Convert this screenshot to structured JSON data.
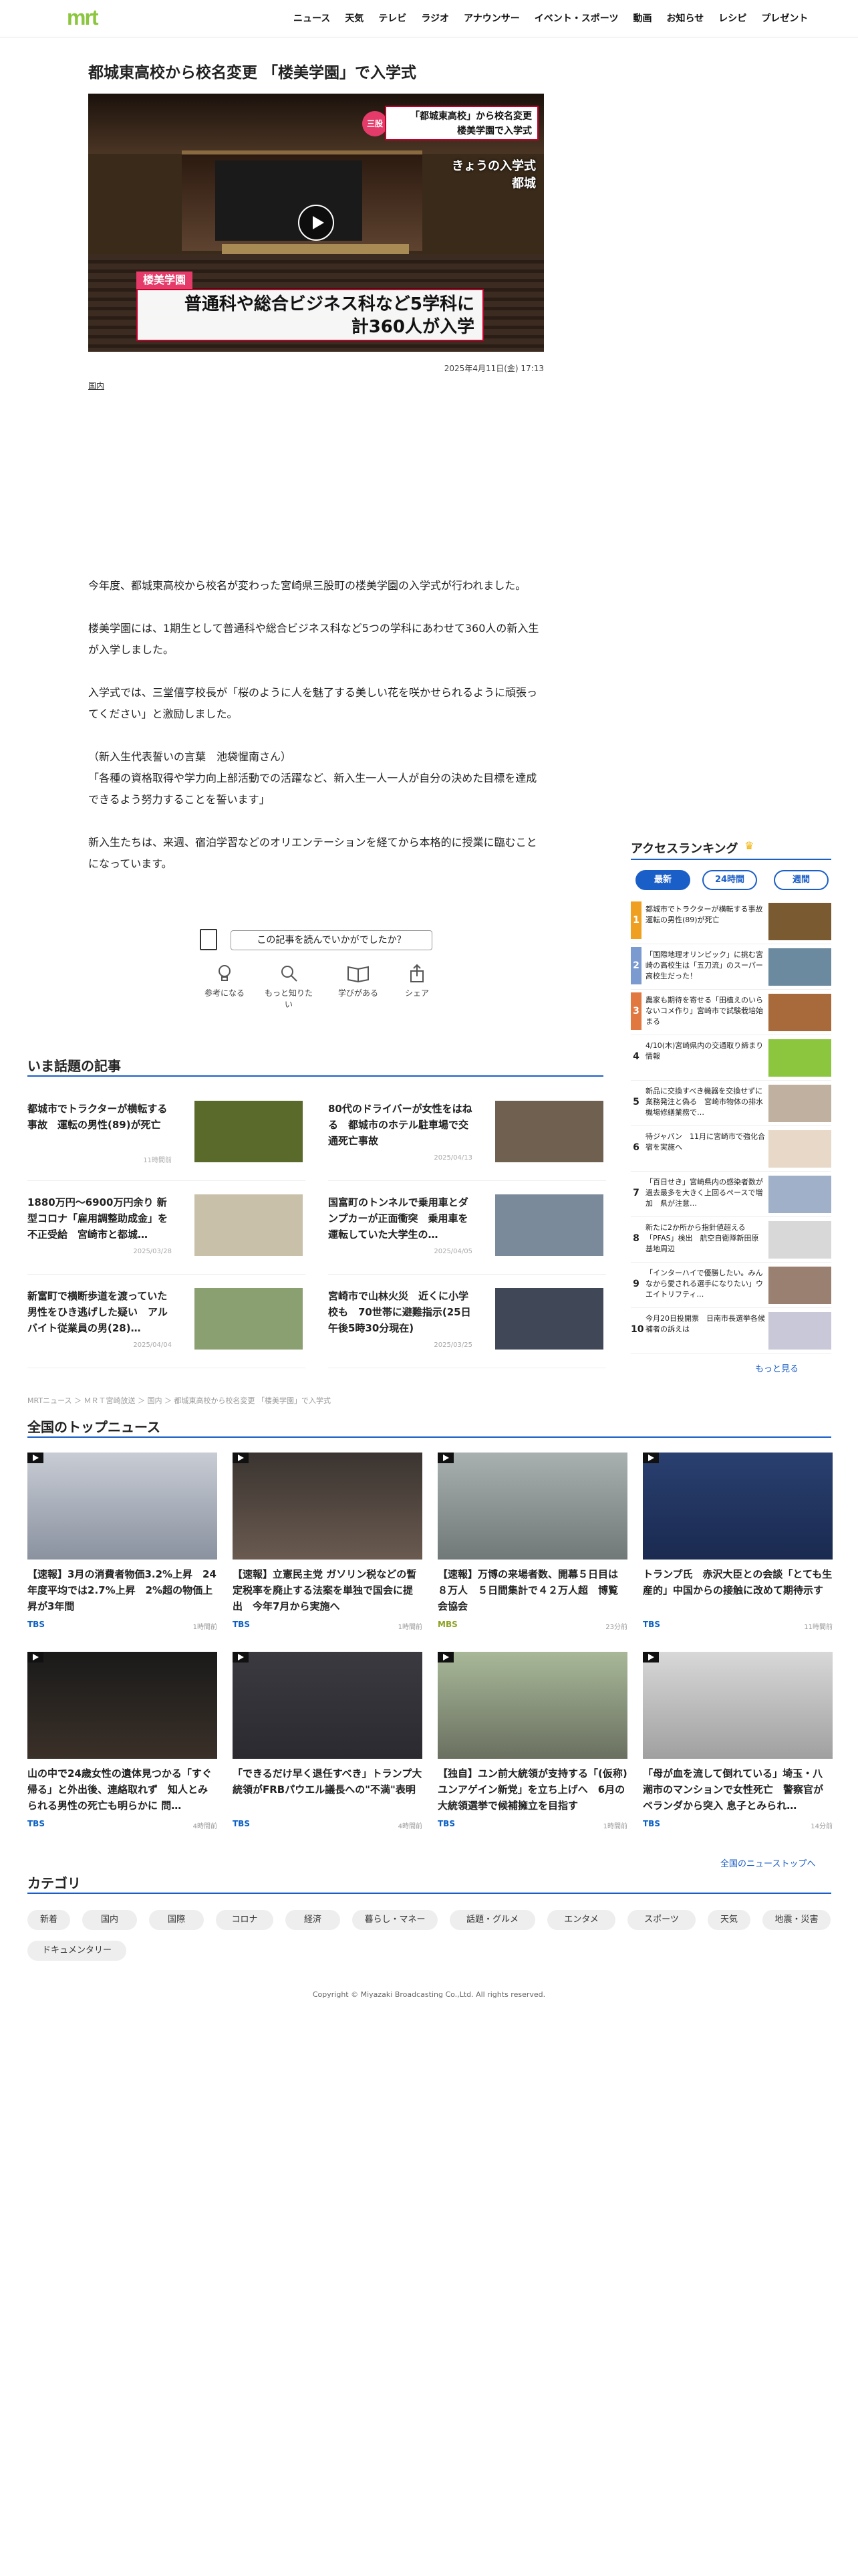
{
  "header": {
    "logo": "mrt",
    "nav": [
      "ニュース",
      "天気",
      "テレビ",
      "ラジオ",
      "アナウンサー",
      "イベント・スポーツ",
      "動画",
      "お知らせ",
      "レシピ",
      "プレゼント"
    ]
  },
  "article": {
    "title": "都城東高校から校名変更 「楼美学園」で入学式",
    "video_captions": {
      "badge": "三股",
      "top": "「都城東高校」から校名変更\n楼美学園で入学式",
      "side": "きょうの入学式\n都城",
      "label": "楼美学園",
      "bottom": "普通科や総合ビジネス科など5学科に\n計360人が入学"
    },
    "date": "2025年4月11日(金) 17:13",
    "category": "国内",
    "paragraphs": [
      "今年度、都城東高校から校名が変わった宮崎県三股町の楼美学園の入学式が行われました。",
      "楼美学園には、1期生として普通科や総合ビジネス科など5つの学科にあわせて360人の新入生が入学しました。",
      "入学式では、三堂僖亨校長が「桜のように人を魅了する美しい花を咲かせられるように頑張ってください」と激励しました。",
      "（新入生代表誓いの言葉　池袋惺南さん）\n「各種の資格取得や学力向上部活動での活躍など、新入生一人一人が自分の決めた目標を達成できるよう努力することを誓います」",
      "新入生たちは、来週、宿泊学習などのオリエンテーションを経てから本格的に授業に臨むことになっています。"
    ]
  },
  "feedback": {
    "question": "この記事を読んでいかがでしたか？",
    "buttons": [
      "参考になる",
      "もっと知りたい",
      "学びがある",
      "シェア"
    ]
  },
  "ranking": {
    "title": "アクセスランキング",
    "tabs": [
      "最新",
      "24時間",
      "週間"
    ],
    "items": [
      {
        "num": "1",
        "text": "都城市でトラクターが横転する事故　運転の男性(89)が死亡",
        "color": "#f0a020"
      },
      {
        "num": "2",
        "text": "「国際地理オリンピック」に挑む宮崎の高校生は「五刀流」のスーパー高校生だった！",
        "color": "#7a9ad0"
      },
      {
        "num": "3",
        "text": "農家も期待を寄せる「田植えのいらないコメ作り」宮崎市で試験栽培始まる",
        "color": "#e07840"
      },
      {
        "num": "4",
        "text": "4/10(木)宮崎県内の交通取り締まり情報",
        "color": ""
      },
      {
        "num": "5",
        "text": "新品に交換すべき機器を交換せずに業務発注と偽る　宮崎市物体の排水機場修繕業務で…",
        "color": ""
      },
      {
        "num": "6",
        "text": "待ジャパン　11月に宮崎市で強化合宿を実施へ",
        "color": ""
      },
      {
        "num": "7",
        "text": "「百日せき」宮崎県内の感染者数が過去最多を大きく上回るペースで増加　県が注意…",
        "color": ""
      },
      {
        "num": "8",
        "text": "新たに2か所から指針値超える「PFAS」検出　航空自衛隊新田原基地周辺",
        "color": ""
      },
      {
        "num": "9",
        "text": "「インターハイで優勝したい。みんなから愛される選手になりたい」ウエイトリフティ…",
        "color": ""
      },
      {
        "num": "10",
        "text": "今月20日投開票　日南市長選挙各候補者の訴えは",
        "color": ""
      }
    ],
    "more": "もっと見る"
  },
  "hot_topics": {
    "title": "いま話題の記事",
    "items": [
      {
        "text": "都城市でトラクターが横転する事故　運転の男性(89)が死亡",
        "date": "11時間前"
      },
      {
        "text": "80代のドライバーが女性をはねる　都城市のホテル駐車場で交通死亡事故",
        "date": "2025/04/13"
      },
      {
        "text": "1880万円〜6900万円余り 新型コロナ「雇用調整助成金」を不正受給　宮崎市と都城…",
        "date": "2025/03/28"
      },
      {
        "text": "国富町のトンネルで乗用車とダンプカーが正面衝突　乗用車を運転していた大学生の…",
        "date": "2025/04/05"
      },
      {
        "text": "新富町で横断歩道を渡っていた男性をひき逃げした疑い　アルバイト従業員の男(28)…",
        "date": "2025/04/04"
      },
      {
        "text": "宮崎市で山林火災　近くに小学校も　70世帯に避難指示(25日午後5時30分現在)",
        "date": "2025/03/25"
      }
    ]
  },
  "breadcrumb": "MRTニュース ＞ ＭＲＴ宮崎放送 ＞ 国内 ＞ 都城東高校から校名変更 「楼美学園」で入学式",
  "top_news": {
    "title": "全国のトップニュース",
    "items": [
      {
        "text": "【速報】3月の消費者物価3.2%上昇　24年度平均では2.7%上昇　2%超の物価上昇が3年間",
        "source": "TBS",
        "time": "1時間前"
      },
      {
        "text": "【速報】立憲民主党 ガソリン税などの暫定税率を廃止する法案を単独で国会に提出　今年7月から実施へ",
        "source": "TBS",
        "time": "1時間前"
      },
      {
        "text": "【速報】万博の来場者数、開幕５日目は８万人　５日間集計で４２万人超　博覧会協会",
        "source": "MBS",
        "time": "23分前"
      },
      {
        "text": "トランプ氏　赤沢大臣との会談「とても生産的」中国からの接触に改めて期待示す",
        "source": "TBS",
        "time": "11時間前"
      },
      {
        "text": "山の中で24歳女性の遺体見つかる「すぐ帰る」と外出後、連絡取れず　知人とみられる男性の死亡も明らかに 問…",
        "source": "TBS",
        "time": "4時間前"
      },
      {
        "text": "「できるだけ早く退任すべき」トランプ大統領がFRBパウエル議長への\"不満\"表明",
        "source": "TBS",
        "time": "4時間前"
      },
      {
        "text": "【独自】ユン前大統領が支持する「(仮称) ユンアゲイン新党」を立ち上げへ　6月の大統領選挙で候補擁立を目指す",
        "source": "TBS",
        "time": "1時間前"
      },
      {
        "text": "「母が血を流して倒れている」埼玉・八潮市のマンションで女性死亡　警察官がベランダから突入 息子とみられ…",
        "source": "TBS",
        "time": "14分前"
      }
    ],
    "more": "全国のニューストップへ"
  },
  "categories": {
    "title": "カテゴリ",
    "items": [
      "新着",
      "国内",
      "国際",
      "コロナ",
      "経済",
      "暮らし・マネー",
      "話題・グルメ",
      "エンタメ",
      "スポーツ",
      "天気",
      "地震・災害",
      "ドキュメンタリー"
    ]
  },
  "footer": {
    "copyright": "Copyright © Miyazaki Broadcasting Co.,Ltd. All rights reserved."
  },
  "colors": {
    "brand": "#8cc63f",
    "accent": "#1a5ec7",
    "telop_pink": "#e43b6a"
  }
}
